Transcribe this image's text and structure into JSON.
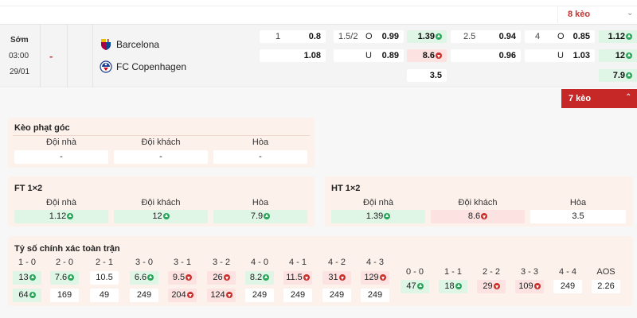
{
  "header": {
    "more_label": "8 kèo"
  },
  "match": {
    "status": "Sớm",
    "time": "03:00",
    "date": "29/01",
    "score_home": "-",
    "score_away": "-",
    "home_team": "Barcelona",
    "away_team": "FC Copenhagen",
    "home_icon": "barcelona-crest-icon",
    "away_icon": "copenhagen-crest-icon"
  },
  "odds": {
    "hdp_line": "1",
    "hdp_home": "0.8",
    "hdp_away": "1.08",
    "ou_line": "1.5/2",
    "ou_over_label": "O",
    "ou_over": "0.99",
    "ou_under_label": "U",
    "ou_under": "0.89",
    "x12_home": "1.39",
    "x12_away": "8.6",
    "x12_draw": "3.5",
    "h1_hdp_line": "2.5",
    "h1_hdp_home": "0.94",
    "h1_hdp_away": "0.96",
    "h1_ou_line": "4",
    "h1_ou_over_label": "O",
    "h1_ou_over": "0.85",
    "h1_ou_under_label": "U",
    "h1_ou_under": "1.03",
    "h1_x12_home": "1.12",
    "h1_x12_away": "12",
    "h1_x12_draw": "7.9"
  },
  "expand_bar": {
    "label": "7 kèo"
  },
  "corner": {
    "title": "Kèo phạt góc",
    "headers": [
      "Đội nhà",
      "Đội khách",
      "Hòa"
    ],
    "values": [
      "-",
      "-",
      "-"
    ]
  },
  "ft": {
    "title": "FT 1×2",
    "headers": [
      "Đội nhà",
      "Đội khách",
      "Hòa"
    ],
    "values": [
      "1.12",
      "12",
      "7.9"
    ]
  },
  "ht": {
    "title": "HT 1×2",
    "headers": [
      "Đội nhà",
      "Đội khách",
      "Hòa"
    ],
    "values": [
      "1.39",
      "8.6",
      "3.5"
    ]
  },
  "correct_score": {
    "title": "Tỷ số chính xác toàn trận",
    "left_headers": [
      "1 - 0",
      "2 - 0",
      "2 - 1",
      "3 - 0",
      "3 - 1",
      "3 - 2",
      "4 - 0",
      "4 - 1",
      "4 - 2",
      "4 - 3"
    ],
    "left_row1": [
      "13",
      "7.6",
      "10.5",
      "6.6",
      "9.5",
      "26",
      "8.2",
      "11.5",
      "31",
      "129"
    ],
    "left_row2": [
      "64",
      "169",
      "49",
      "249",
      "204",
      "124",
      "249",
      "249",
      "249",
      "249"
    ],
    "right_headers": [
      "0 - 0",
      "1 - 1",
      "2 - 2",
      "3 - 3",
      "4 - 4",
      "AOS"
    ],
    "right_row1": [
      "47",
      "18",
      "29",
      "109",
      "249",
      "2.26"
    ]
  }
}
